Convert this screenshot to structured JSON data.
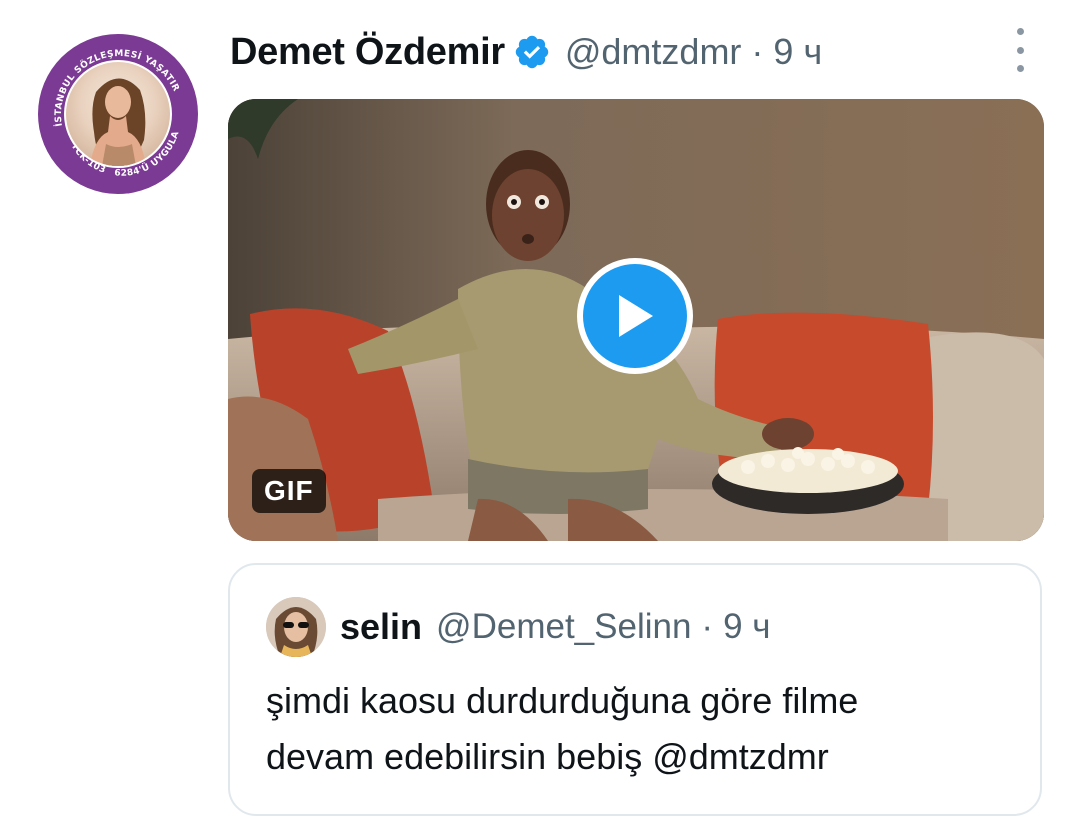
{
  "tweet": {
    "author": {
      "display_name": "Demet Özdemir",
      "verified": true,
      "handle": "@dmtzdmr",
      "avatar_badge_text_top": "İSTANBUL SÖZLEŞMESİ YAŞATIR",
      "avatar_badge_text_left": "TCK-103",
      "avatar_badge_text_bottom": "6284'Ü UYGULA"
    },
    "separator": "·",
    "time": "9 ч",
    "more_icon": "more-vertical-icon",
    "media": {
      "badge": "GIF",
      "play_icon": "play-icon"
    },
    "quote": {
      "display_name": "selin",
      "handle": "@Demet_Selinn",
      "separator": "·",
      "time": "9 ч",
      "text_line1": "şimdi kaosu durdurduğuna göre filme",
      "text_line2": "devam edebilirsin bebiş @dmtzdmr"
    }
  },
  "colors": {
    "accent": "#1d9bf0",
    "secondary_text": "#536471",
    "badge_purple": "#7b3a93",
    "border": "#e1e8ed"
  }
}
